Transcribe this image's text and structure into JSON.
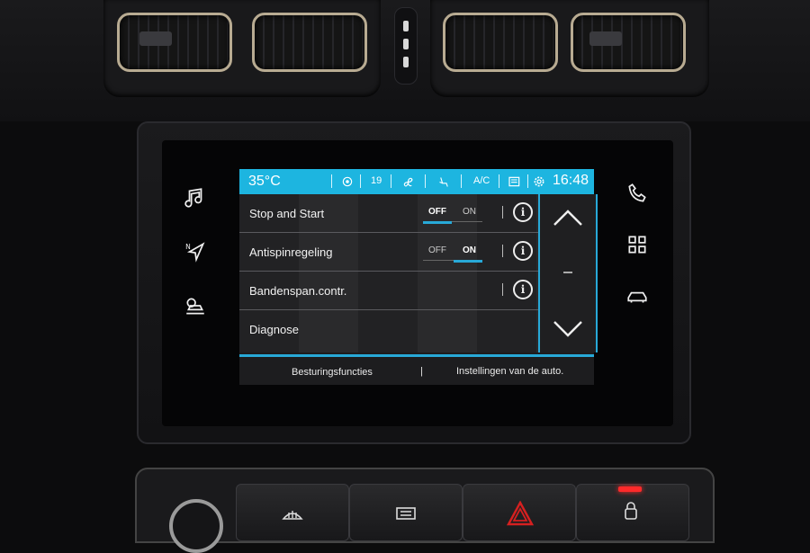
{
  "status_bar": {
    "temperature": "35°C",
    "radio_freq": "19",
    "ac_label": "A/C",
    "time": "16:48"
  },
  "settings_list": {
    "rows": [
      {
        "label": "Stop and Start",
        "has_toggle": true,
        "off_label": "OFF",
        "on_label": "ON",
        "selected": "OFF",
        "has_info": true
      },
      {
        "label": "Antispinregeling",
        "has_toggle": true,
        "off_label": "OFF",
        "on_label": "ON",
        "selected": "ON",
        "has_info": true
      },
      {
        "label": "Bandenspan.contr.",
        "has_toggle": false,
        "has_info": true
      },
      {
        "label": "Diagnose",
        "has_toggle": false,
        "has_info": false
      }
    ],
    "info_glyph": "i"
  },
  "footer": {
    "left_label": "Besturingsfuncties",
    "separator": "|",
    "right_label": "Instellingen van de auto."
  },
  "icons": {
    "left_side": [
      "music-icon",
      "navigation-icon",
      "settings-car-icon"
    ],
    "right_side": [
      "phone-icon",
      "apps-grid-icon",
      "car-icon"
    ],
    "scroll": [
      "chevron-up-icon",
      "chevron-down-icon"
    ]
  },
  "colors": {
    "accent": "#1db5e0",
    "hazard_red": "#d62020"
  }
}
